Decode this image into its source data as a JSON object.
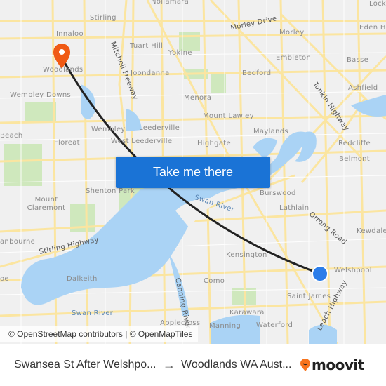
{
  "map": {
    "labels": {
      "nollamara": "Nollamara",
      "stirling": "Stirling",
      "morley_drive": "Morley Drive",
      "morley": "Morley",
      "eden_hill": "Eden Hi",
      "lockridge": "Lock",
      "innaloo": "Innaloo",
      "tuart_hill": "Tuart Hill",
      "yokine": "Yokine",
      "embleton": "Embleton",
      "bassendean": "Basse",
      "mitchell_freeway": "Mitchell Freeway",
      "woodlands": "Woodlands",
      "joondanna": "Joondanna",
      "bedford": "Bedford",
      "wembley_downs": "Wembley Downs",
      "menora": "Menora",
      "ashfield": "Ashfield",
      "tonkin_highway": "Tonkin Highway",
      "mount_lawley": "Mount Lawley",
      "maylands": "Maylands",
      "beach": "Beach",
      "wembley": "Wembley",
      "leederville": "Leederville",
      "floreat": "Floreat",
      "west_leederville": "West Leederville",
      "highgate": "Highgate",
      "redcliffe": "Redcliffe",
      "belmont": "Belmont",
      "shenton_park": "Shenton Park",
      "burswood": "Burswood",
      "swan_river_1": "Swan River",
      "mount_claremont": "Mount Claremont",
      "lathlain": "Lathlain",
      "orrong_road": "Orrong Road",
      "kewdale": "Kewdale",
      "stirling_highway": "Stirling Highway",
      "nedlands": "anbourne",
      "kensington": "Kensington",
      "welshpool": "Welshpool",
      "dalkeith": "Dalkeith",
      "como": "Como",
      "canning_river": "Canning River",
      "saint_james": "Saint James",
      "leach_highway": "Leach Highway",
      "swan_river_2": "Swan River",
      "karawara": "Karawara",
      "applecross": "Applecross",
      "manning": "Manning",
      "waterford": "Waterford",
      "cottesloe": "oe"
    },
    "origin_marker": "blue-dot-icon",
    "destination_marker": "orange-pin-icon",
    "colors": {
      "land": "#f0f0f0",
      "water": "#aad3f5",
      "road": "#fbe7a1",
      "park": "#c9e6b5",
      "route": "#222222",
      "pin": "#f05a14",
      "origin": "#2b7de9"
    },
    "attribution": "© OpenStreetMap contributors | © OpenMapTiles"
  },
  "cta_label": "Take me there",
  "footer": {
    "from": "Swansea St After Welshpo...",
    "arrow": "→",
    "to": "Woodlands WA Aust...",
    "logo": "moovit"
  }
}
